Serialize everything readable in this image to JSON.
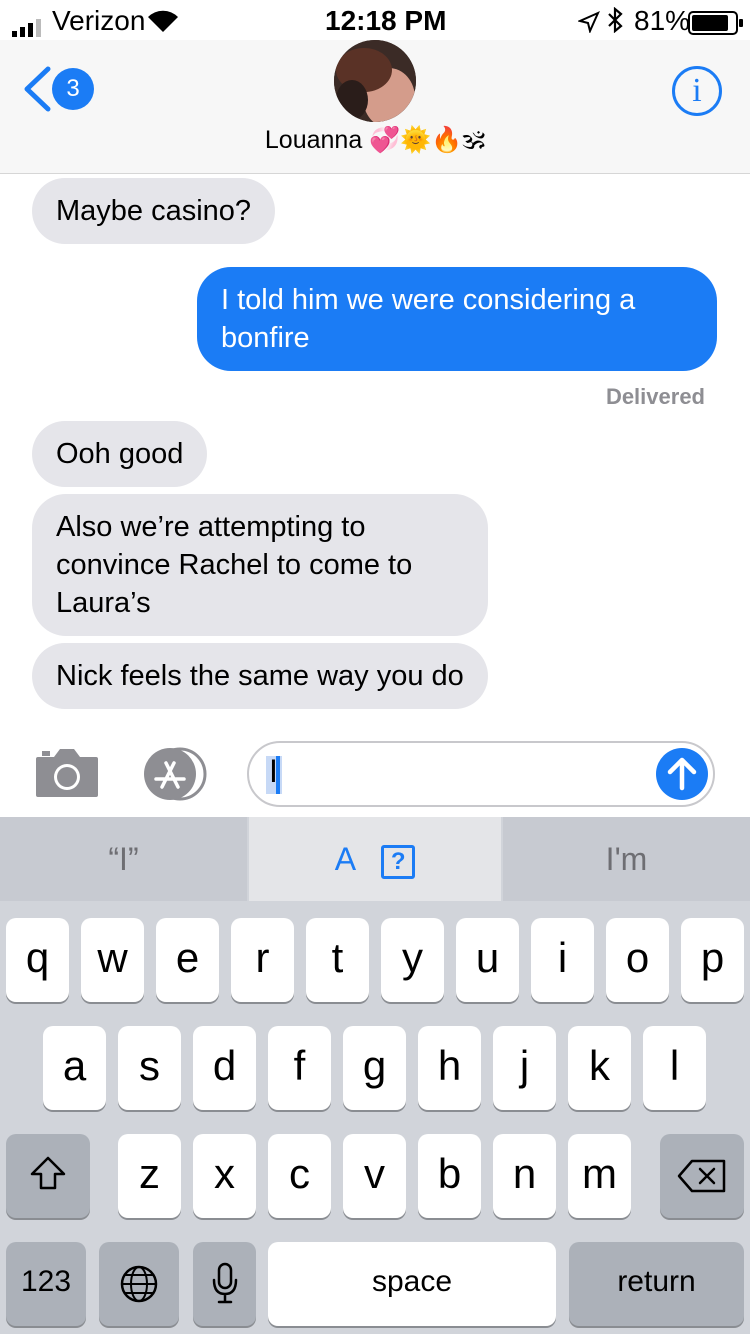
{
  "status_bar": {
    "carrier": "Verizon",
    "time": "12:18 PM",
    "battery": "81%"
  },
  "nav": {
    "back_badge": "3",
    "contact_name": "Louanna 💞🌞🔥🕉",
    "info_label": "i"
  },
  "messages": [
    {
      "direction": "incoming",
      "text": "Maybe casino?"
    },
    {
      "direction": "outgoing",
      "text": "I told him we were considering a bonfire"
    },
    {
      "direction": "incoming",
      "text": "Ooh good"
    },
    {
      "direction": "incoming",
      "text": "Also we’re attempting to convince Rachel to come to Laura’s"
    },
    {
      "direction": "incoming",
      "text": "Nick feels the same way you do"
    }
  ],
  "delivered_label": "Delivered",
  "composer": {
    "text": "I"
  },
  "suggestions": [
    "“I”",
    "A",
    "I'm"
  ],
  "keyboard": {
    "row1": [
      "q",
      "w",
      "e",
      "r",
      "t",
      "y",
      "u",
      "i",
      "o",
      "p"
    ],
    "row2": [
      "a",
      "s",
      "d",
      "f",
      "g",
      "h",
      "j",
      "k",
      "l"
    ],
    "row3": [
      "z",
      "x",
      "c",
      "v",
      "b",
      "n",
      "m"
    ],
    "numbers_label": "123",
    "space_label": "space",
    "return_label": "return"
  },
  "colors": {
    "accent": "#1b7cf5",
    "incoming_bubble": "#e5e5ea",
    "keyboard_bg": "#d1d4da"
  }
}
